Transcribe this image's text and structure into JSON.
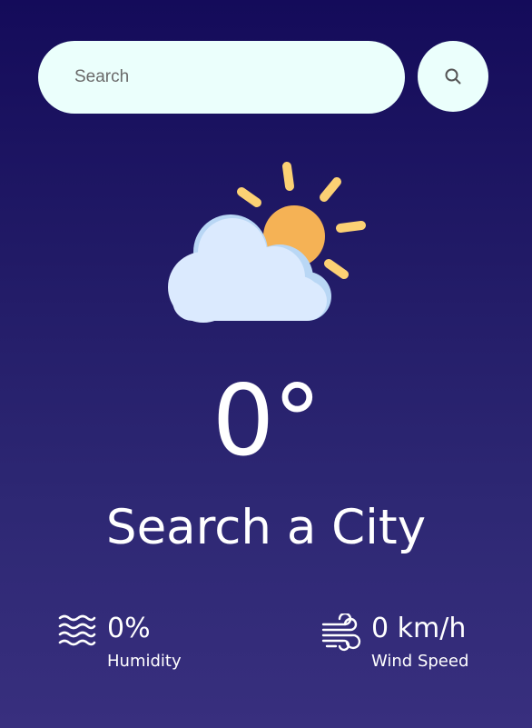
{
  "search": {
    "placeholder": "Search",
    "value": ""
  },
  "weather": {
    "icon": "partly-cloudy-icon",
    "temperature": "0°",
    "city": "Search a City"
  },
  "details": {
    "humidity": {
      "icon": "humidity-icon",
      "value": "0%",
      "label": "Humidity"
    },
    "wind": {
      "icon": "wind-icon",
      "value": "0 km/h",
      "label": "Wind Speed"
    }
  },
  "colors": {
    "background_top": "#140b5a",
    "background_bottom": "#382f7e",
    "input_bg": "#ebfffc",
    "sun": "#f5b255",
    "sun_rays": "#fcd174",
    "cloud": "#dbeafe",
    "cloud_shadow": "#b9d7f5",
    "text": "#ffffff"
  }
}
